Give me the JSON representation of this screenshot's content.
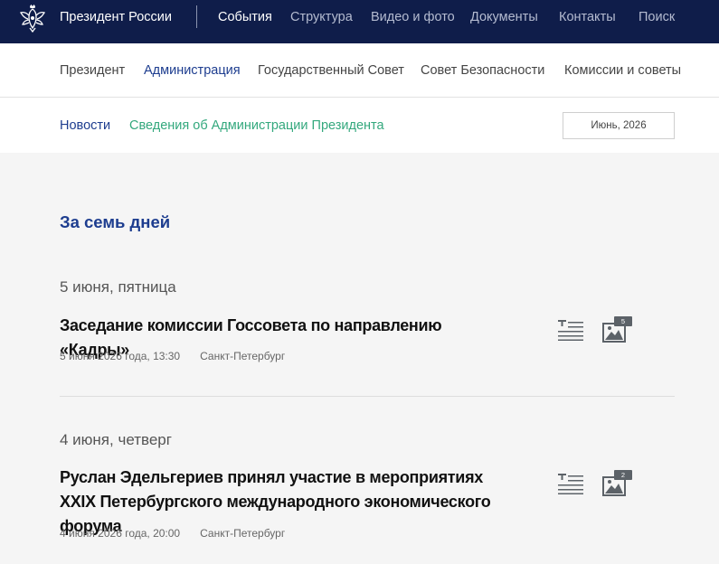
{
  "header": {
    "site_title": "Президент России",
    "nav": [
      "События",
      "Структура",
      "Видео и фото",
      "Документы",
      "Контакты",
      "Поиск"
    ]
  },
  "subnav": [
    "Президент",
    "Администрация",
    "Государственный Совет",
    "Совет Безопасности",
    "Комиссии и советы"
  ],
  "filter": {
    "news": "Новости",
    "admin_info": "Сведения об Администрации Президента",
    "month": "Июнь, 2026"
  },
  "section_title": "За семь дней",
  "days": [
    {
      "heading": "5 июня, пятница",
      "event": {
        "title": "Заседание комиссии Госсовета по направлению «Кадры»",
        "datetime": "5 июня 2026 года, 13:30",
        "place": "Санкт-Петербург",
        "photo_count": "5"
      }
    },
    {
      "heading": "4 июня, четверг",
      "event": {
        "title": "Руслан Эдельгериев принял участие в мероприятиях XXIX Петербургского международного экономического форума",
        "datetime": "4 июня 2026 года, 20:00",
        "place": "Санкт-Петербург",
        "photo_count": "2"
      }
    }
  ],
  "colors": {
    "header_bg": "#0f1d4a",
    "link_blue": "#1d3d8f",
    "link_green": "#33a87d",
    "page_bg": "#f5f5f5"
  },
  "icons": [
    "emblem-icon",
    "text-version-icon",
    "photo-gallery-icon"
  ]
}
